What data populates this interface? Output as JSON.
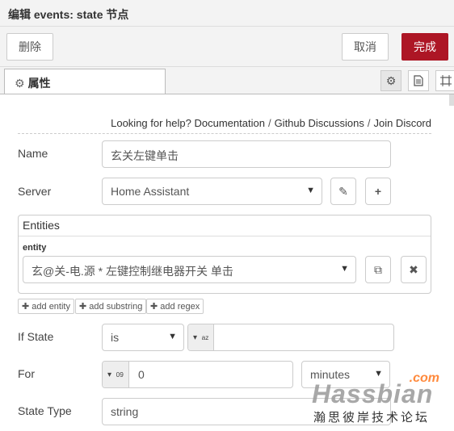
{
  "window": {
    "title": "编辑 events: state 节点"
  },
  "toolbar": {
    "delete_label": "删除",
    "cancel_label": "取消",
    "done_label": "完成"
  },
  "tabs": [
    {
      "label": "属性",
      "icon": "gear-icon"
    }
  ],
  "tab_icons": [
    "gear-icon",
    "document-icon",
    "frame-icon"
  ],
  "help": {
    "prefix": "Looking for help?",
    "links": [
      "Documentation",
      "Github Discussions",
      "Join Discord"
    ],
    "separator": "/"
  },
  "form": {
    "name": {
      "label": "Name",
      "value": "玄关左键单击"
    },
    "server": {
      "label": "Server",
      "value": "Home Assistant"
    },
    "entities": {
      "header": "Entities",
      "entity_label": "entity",
      "value": "玄@关-电.源 * 左键控制继电器开关 单击",
      "add_buttons": [
        "add entity",
        "add substring",
        "add regex"
      ]
    },
    "if_state": {
      "label": "If State",
      "operator": "is",
      "type_icon": "a-z",
      "value": ""
    },
    "for": {
      "label": "For",
      "type_icon": "0-9",
      "value": "0",
      "unit": "minutes"
    },
    "state_type": {
      "label": "State Type",
      "value": "string"
    }
  },
  "watermark": {
    "com": ".com",
    "main": "Hassbian",
    "sub": "瀚思彼岸技术论坛"
  }
}
